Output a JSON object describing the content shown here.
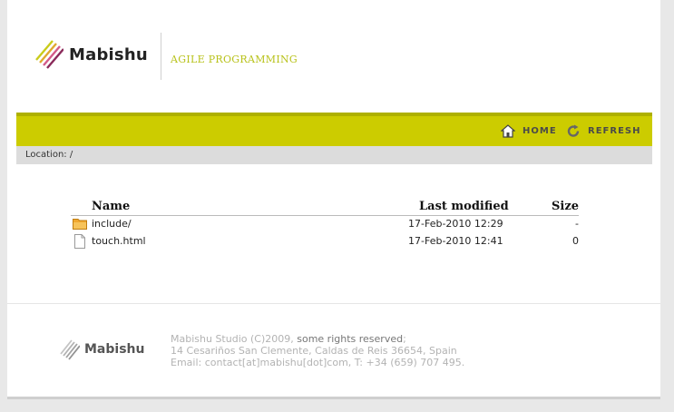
{
  "header": {
    "logo_text": "Mabishu",
    "tagline": "AGILE PROGRAMMING"
  },
  "nav": {
    "home_label": "HOME",
    "refresh_label": "REFRESH"
  },
  "location": {
    "label": "Location: /"
  },
  "listing": {
    "columns": {
      "name": "Name",
      "modified": "Last modified",
      "size": "Size"
    },
    "rows": [
      {
        "icon": "folder-icon",
        "name": "include/",
        "modified": "17-Feb-2010 12:29",
        "size": "-"
      },
      {
        "icon": "file-icon",
        "name": "touch.html",
        "modified": "17-Feb-2010 12:41",
        "size": "0"
      }
    ]
  },
  "footer": {
    "logo_text": "Mabishu",
    "line1_prefix": "Mabishu Studio (C)2009, ",
    "line1_rights": "some rights reserved",
    "line1_suffix": ";",
    "line2": "14 Cesariños San Clemente, Caldas de Reis 36654, Spain",
    "line3": "Email: contact[at]mabishu[dot]com, T: +34 (659) 707 495."
  },
  "colors": {
    "accent": "#cccc00",
    "accent_dark": "#aeb000",
    "tagline": "#b8c21a"
  }
}
